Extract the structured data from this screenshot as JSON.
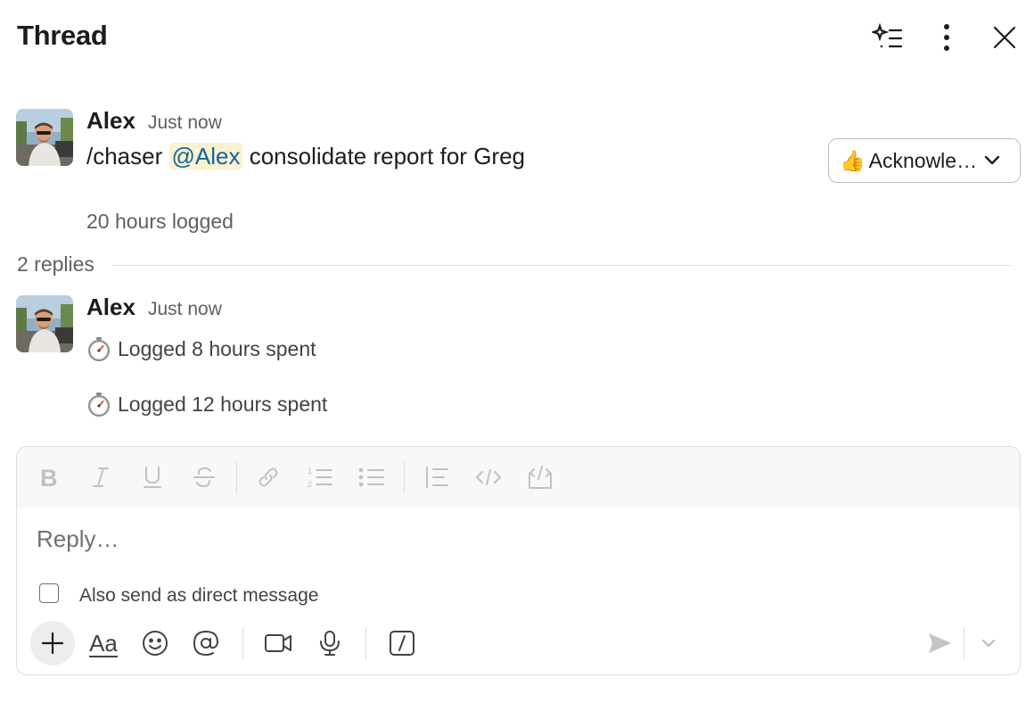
{
  "header": {
    "title": "Thread",
    "icons": [
      "ai-summary-icon",
      "more-vertical-icon",
      "close-icon"
    ]
  },
  "parent_message": {
    "author": "Alex",
    "time": "Just now",
    "text_prefix": "/chaser",
    "mention": "@Alex",
    "text_suffix": "consolidate report for Greg",
    "action_button": {
      "emoji": "👍",
      "label": "Acknowle…"
    },
    "footer": "20 hours logged"
  },
  "replies": {
    "count_label": "2 replies",
    "author": "Alex",
    "time": "Just now",
    "lines": [
      "Logged 8 hours spent",
      "Logged 12 hours spent"
    ]
  },
  "composer": {
    "placeholder": "Reply…",
    "dm_checkbox_label": "Also send as direct message",
    "dm_checked": false,
    "formatting": [
      "bold",
      "italic",
      "underline",
      "strikethrough",
      "link",
      "ordered-list",
      "bulleted-list",
      "blockquote",
      "code",
      "code-block"
    ],
    "text_format_label": "Aa",
    "actions": [
      "plus",
      "text-format",
      "emoji",
      "mention",
      "video",
      "microphone",
      "slash-command",
      "send",
      "send-options"
    ]
  },
  "colors": {
    "mention_text": "#1264a3",
    "mention_bg": "#fcf1cf",
    "muted_text": "#616061",
    "divider": "#dddddd"
  }
}
